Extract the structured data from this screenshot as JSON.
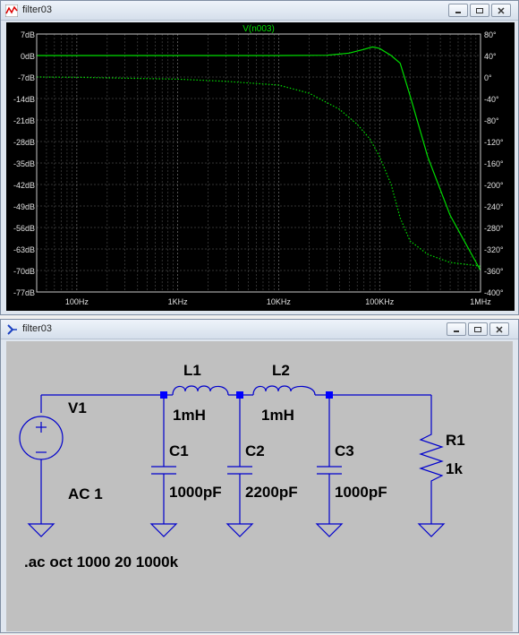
{
  "plot_window": {
    "title": "filter03"
  },
  "schematic_window": {
    "title": "filter03"
  },
  "chart_data": {
    "type": "line",
    "title": "V(n003)",
    "x_scale": "log",
    "xlim": [
      40,
      1000000
    ],
    "ylim_left": [
      -77,
      7
    ],
    "ylim_right": [
      -400,
      80
    ],
    "x_ticks": [
      100,
      1000,
      10000,
      100000,
      1000000
    ],
    "x_tick_labels": [
      "100Hz",
      "1KHz",
      "10KHz",
      "100KHz",
      "1MHz"
    ],
    "left_ticks": [
      7,
      0,
      -7,
      -14,
      -21,
      -28,
      -35,
      -42,
      -49,
      -56,
      -63,
      -70,
      -77
    ],
    "left_tick_labels": [
      "7dB",
      "0dB",
      "-7dB",
      "-14dB",
      "-21dB",
      "-28dB",
      "-35dB",
      "-42dB",
      "-49dB",
      "-56dB",
      "-63dB",
      "-70dB",
      "-77dB"
    ],
    "right_ticks": [
      80,
      40,
      0,
      -40,
      -80,
      -120,
      -160,
      -200,
      -240,
      -280,
      -320,
      -360,
      -400
    ],
    "right_tick_labels": [
      "80°",
      "40°",
      "0°",
      "-40°",
      "-80°",
      "-120°",
      "-160°",
      "-200°",
      "-240°",
      "-280°",
      "-320°",
      "-360°",
      "-400°"
    ],
    "grid": true,
    "series": [
      {
        "name": "V(n003)",
        "style": "solid",
        "axis": "left",
        "color": "#00dd00",
        "x": [
          40,
          100,
          1000,
          10000,
          30000,
          50000,
          70000,
          85000,
          100000,
          130000,
          160000,
          200000,
          300000,
          500000,
          1000000
        ],
        "y": [
          0,
          0,
          0,
          0,
          0.1,
          0.8,
          2,
          2.8,
          2.3,
          0,
          -2.5,
          -13,
          -33,
          -52,
          -70
        ]
      },
      {
        "name": "",
        "style": "dotted",
        "axis": "right",
        "color": "#00dd00",
        "x": [
          40,
          100,
          1000,
          3000,
          10000,
          20000,
          40000,
          60000,
          80000,
          100000,
          130000,
          160000,
          200000,
          300000,
          500000,
          1000000
        ],
        "y": [
          0,
          -0.5,
          -4,
          -8,
          -15,
          -30,
          -60,
          -88,
          -115,
          -148,
          -200,
          -262,
          -305,
          -330,
          -345,
          -352
        ]
      }
    ]
  },
  "schematic": {
    "labels": {
      "v1": "V1",
      "v1_value": "AC 1",
      "l1": "L1",
      "l1_value": "1mH",
      "l2": "L2",
      "l2_value": "1mH",
      "c1": "C1",
      "c1_value": "1000pF",
      "c2": "C2",
      "c2_value": "2200pF",
      "c3": "C3",
      "c3_value": "1000pF",
      "r1": "R1",
      "r1_value": "1k",
      "directive": ".ac oct 1000 20 1000k"
    },
    "wire_color": "#0000cc"
  }
}
